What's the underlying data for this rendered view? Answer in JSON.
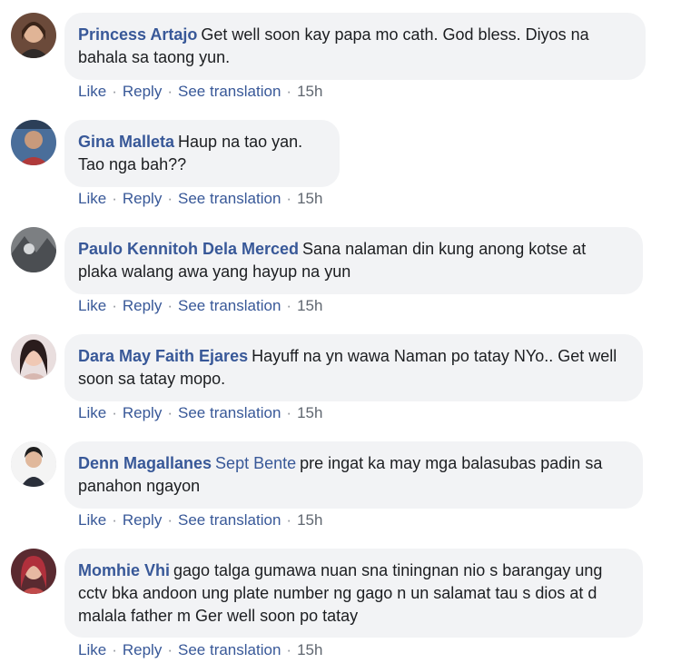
{
  "comments": [
    {
      "author": "Princess Artajo",
      "tag": "",
      "text": "Get well soon kay papa mo cath. God bless. Diyos na bahala sa taong yun.",
      "actions": {
        "like": "Like",
        "reply": "Reply",
        "translate": "See translation",
        "time": "15h"
      }
    },
    {
      "author": "Gina Malleta",
      "tag": "",
      "text": "Haup na tao yan. Tao nga bah??",
      "actions": {
        "like": "Like",
        "reply": "Reply",
        "translate": "See translation",
        "time": "15h"
      }
    },
    {
      "author": "Paulo Kennitoh Dela Merced",
      "tag": "",
      "text": "Sana nalaman din kung anong kotse at plaka walang awa yang hayup na yun",
      "actions": {
        "like": "Like",
        "reply": "Reply",
        "translate": "See translation",
        "time": "15h"
      }
    },
    {
      "author": "Dara May Faith Ejares",
      "tag": "",
      "text": "Hayuff na yn wawa Naman po tatay NYo.. Get well soon sa tatay mopo.",
      "actions": {
        "like": "Like",
        "reply": "Reply",
        "translate": "See translation",
        "time": "15h"
      }
    },
    {
      "author": "Denn Magallanes",
      "tag": "Sept Bente",
      "text": "pre ingat ka may mga balasubas padin sa panahon ngayon",
      "actions": {
        "like": "Like",
        "reply": "Reply",
        "translate": "See translation",
        "time": "15h"
      }
    },
    {
      "author": "Momhie Vhi",
      "tag": "",
      "text": "gago talga gumawa nuan sna tiningnan nio s barangay ung cctv bka andoon ung plate number ng gago n un salamat tau s dios at d malala father m Ger well soon po tatay",
      "actions": {
        "like": "Like",
        "reply": "Reply",
        "translate": "See translation",
        "time": "15h"
      }
    }
  ],
  "colors": {
    "link": "#385898",
    "bubble": "#f2f3f5",
    "text": "#1c1e21"
  }
}
